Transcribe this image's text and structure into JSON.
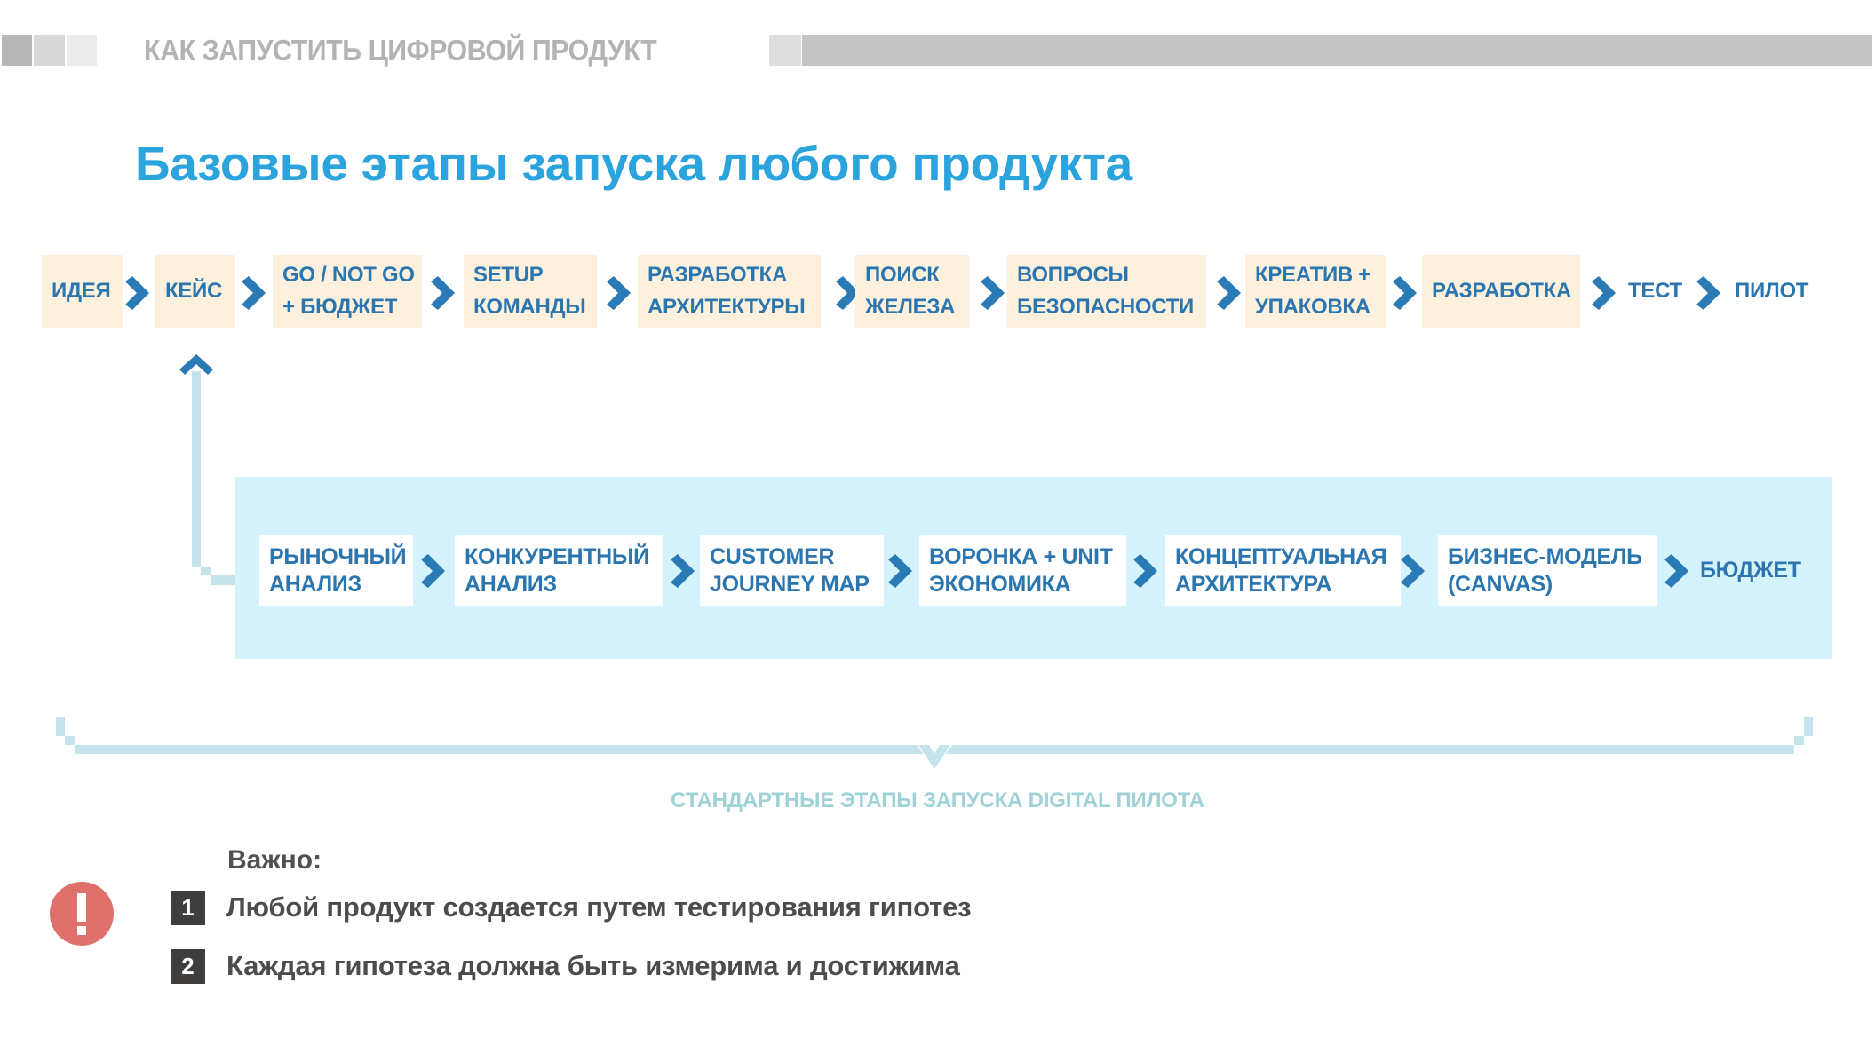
{
  "header": {
    "title": "КАК ЗАПУСТИТЬ ЦИФРОВОЙ ПРОДУКТ",
    "colors": {
      "dark": "#b8b8b8",
      "mid": "#d8d8d8",
      "light": "#ececec",
      "bar": "#c4c4c4"
    }
  },
  "page_title": "Базовые этапы запуска любого продукта",
  "top_flow": {
    "steps": [
      {
        "lines": [
          "ИДЕЯ"
        ],
        "highlighted": true
      },
      {
        "lines": [
          "КЕЙС"
        ],
        "highlighted": true
      },
      {
        "lines": [
          "GO / NOT GO",
          "+ БЮДЖЕТ"
        ],
        "highlighted": true
      },
      {
        "lines": [
          "SETUP",
          "КОМАНДЫ"
        ],
        "highlighted": true
      },
      {
        "lines": [
          "РАЗРАБОТКА",
          "АРХИТЕКТУРЫ"
        ],
        "highlighted": true
      },
      {
        "lines": [
          "ПОИСК",
          "ЖЕЛЕЗА"
        ],
        "highlighted": true
      },
      {
        "lines": [
          "ВОПРОСЫ",
          "БЕЗОПАСНОСТИ"
        ],
        "highlighted": true
      },
      {
        "lines": [
          "КРЕАТИВ +",
          "УПАКОВКА"
        ],
        "highlighted": true
      },
      {
        "lines": [
          "РАЗРАБОТКА"
        ],
        "highlighted": true
      },
      {
        "lines": [
          "ТЕСТ"
        ],
        "highlighted": false
      },
      {
        "lines": [
          "ПИЛОТ"
        ],
        "highlighted": false
      }
    ]
  },
  "bottom_flow": {
    "steps": [
      {
        "lines": [
          "РЫНОЧНЫЙ",
          "АНАЛИЗ"
        ],
        "highlighted": true
      },
      {
        "lines": [
          "КОНКУРЕНТНЫЙ",
          "АНАЛИЗ"
        ],
        "highlighted": true
      },
      {
        "lines": [
          "CUSTOMER",
          "JOURNEY MAP"
        ],
        "highlighted": true
      },
      {
        "lines": [
          "ВОРОНКА + UNIT",
          "ЭКОНОМИКА"
        ],
        "highlighted": true
      },
      {
        "lines": [
          "КОНЦЕПТУАЛЬНАЯ",
          "АРХИТЕКТУРА"
        ],
        "highlighted": true
      },
      {
        "lines": [
          "БИЗНЕС-МОДЕЛЬ",
          "(CANVAS)"
        ],
        "highlighted": true
      },
      {
        "lines": [
          "БЮДЖЕТ"
        ],
        "highlighted": false
      }
    ]
  },
  "pilot_caption": "СТАНДАРТНЫЕ ЭТАПЫ ЗАПУСКА DIGITAL ПИЛОТА",
  "notes": {
    "title": "Важно:",
    "icon": "exclamation-icon",
    "items": [
      {
        "num": "1",
        "text": "Любой продукт создается путем тестирования гипотез"
      },
      {
        "num": "2",
        "text": "Каждая гипотеза должна быть измерима и достижима"
      }
    ]
  },
  "colors": {
    "accent": "#2ba3dc",
    "step_text": "#2c76b0",
    "arrow": "#2a7ab5",
    "top_box": "#fdf0dc",
    "panel": "#d5f3fc",
    "connector": "#c4e3ea",
    "alert": "#e0706b"
  }
}
